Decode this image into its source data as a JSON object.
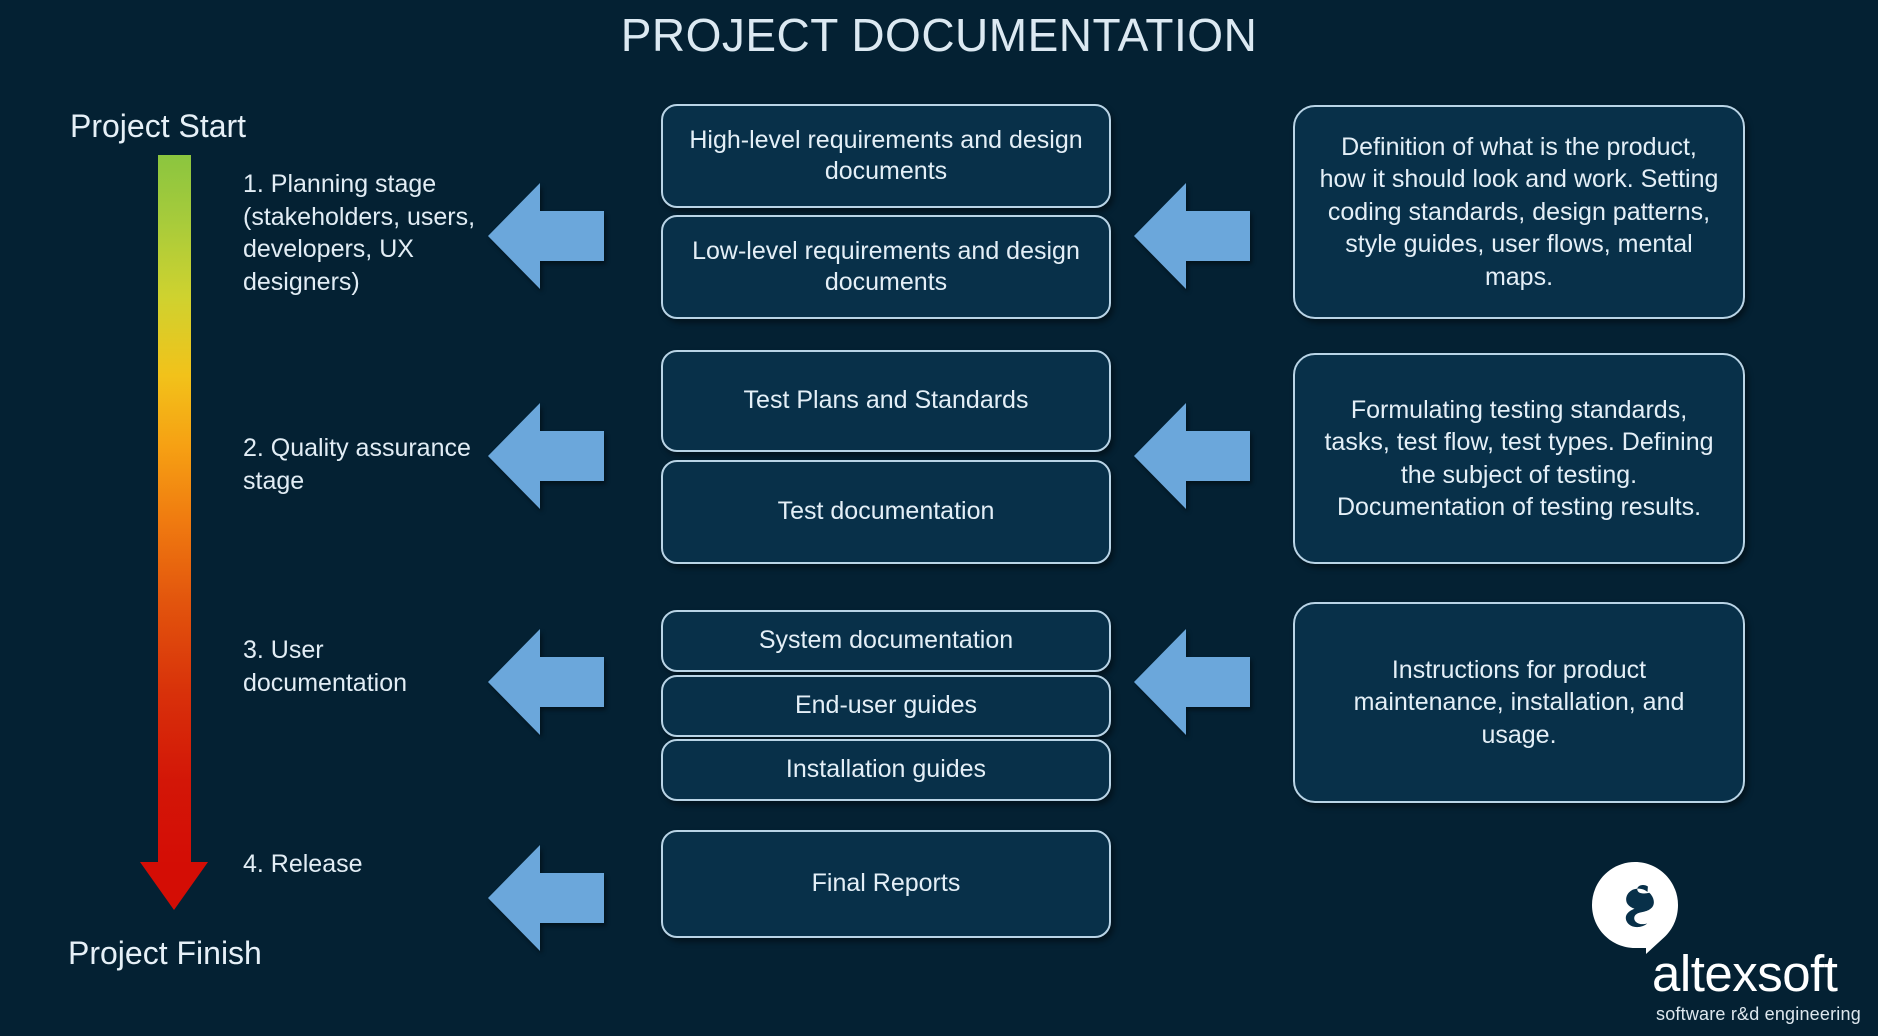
{
  "title": "PROJECT DOCUMENTATION",
  "timeline": {
    "start_label": "Project Start",
    "finish_label": "Project Finish",
    "gradient_from": "#8bc53f",
    "gradient_to": "#d40d05"
  },
  "accent": {
    "arrow_blue": "#6ba7db",
    "box_fill": "#083049",
    "box_border": "#b9d4e6",
    "background": "#042133",
    "text": "#e4eff7"
  },
  "stages": [
    {
      "label": "1. Planning stage (stakeholders, users, developers, UX designers)",
      "documents": [
        "High-level requirements and design documents",
        "Low-level requirements and design documents"
      ],
      "description": "Definition of what is the product, how it should look and work. Setting coding standards, design patterns, style guides, user flows, mental maps."
    },
    {
      "label": "2. Quality assurance stage",
      "documents": [
        "Test Plans and Standards",
        "Test documentation"
      ],
      "description": "Formulating testing standards, tasks, test flow, test types. Defining the subject of testing. Documentation of testing results."
    },
    {
      "label": "3. User documentation",
      "documents": [
        "System documentation",
        "End-user guides",
        "Installation guides"
      ],
      "description": "Instructions for product maintenance, installation, and usage."
    },
    {
      "label": "4. Release",
      "documents": [
        "Final Reports"
      ],
      "description": ""
    }
  ],
  "logo": {
    "wordmark": "altexsoft",
    "tagline": "software r&d engineering",
    "mark_name": "altexsoft-speech-bubble-mark"
  }
}
